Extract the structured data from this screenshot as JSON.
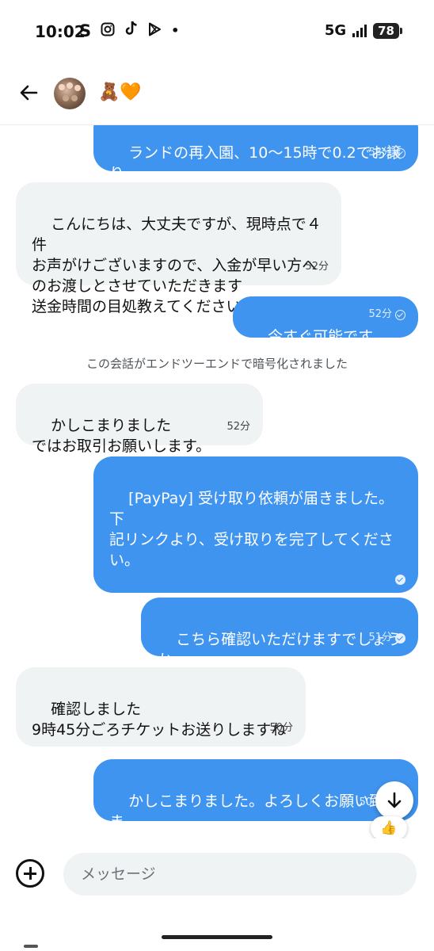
{
  "status_bar": {
    "time": "10:02",
    "app_icons": [
      "S",
      "instagram-icon",
      "tiktok-icon",
      "play-icon",
      "•"
    ],
    "network": "5G",
    "battery": "78"
  },
  "header": {
    "name": "🧸🧡"
  },
  "messages": [
    {
      "dir": "out",
      "text": "ランドの再入園、10〜15時で0.2でお譲り\nいただくことは可能でしょうか？",
      "time": "53分",
      "read": false
    },
    {
      "dir": "in",
      "text": "こんにちは、大丈夫ですが、現時点で４件\nお声がけございますので、入金が早い方へ\nのお渡しとさせていただきます\n送金時間の目処教えてください",
      "time": "52分"
    },
    {
      "dir": "out",
      "text": "今すぐ可能です",
      "time": "52分",
      "read": false
    },
    {
      "dir": "in",
      "text": "かしこまりました\nではお取引お願いします。",
      "time": "52分"
    },
    {
      "dir": "out",
      "text": "[PayPay] 受け取り依頼が届きました。下\n記リンクより、受け取りを完了してくださ\nい。\n\n",
      "link": "pay.paypay.ne.jp/U5wbWxc40AxQHGrL",
      "time": "",
      "read": true
    },
    {
      "dir": "out",
      "text": "こちら確認いただけますでしょうか",
      "time": "51分",
      "read": true
    },
    {
      "dir": "in",
      "text": "確認しました\n9時45分ごろチケットお送りしますね",
      "time": "50分"
    },
    {
      "dir": "out",
      "text": "かしこまりました。よろしくお願い致しま\nす",
      "time": "50",
      "read": false
    }
  ],
  "system_note": "この会話がエンドツーエンドで暗号化されました",
  "reaction": "👍",
  "composer": {
    "placeholder": "メッセージ"
  },
  "colors": {
    "outgoing_bubble": "#3f94f0",
    "incoming_bubble": "#eff3f4"
  }
}
